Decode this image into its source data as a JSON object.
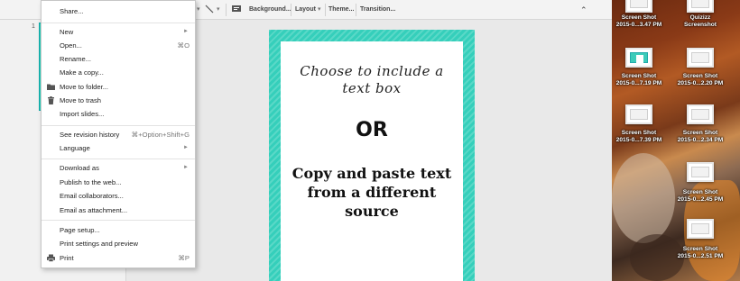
{
  "toolbar": {
    "background": "Background...",
    "layout": "Layout",
    "theme": "Theme...",
    "transition": "Transition...",
    "dropdown_arrow": "▾",
    "collapse_glyph": "⌃"
  },
  "filmstrip": {
    "slide_number": "1"
  },
  "slide": {
    "line1": "Choose to include a",
    "line2": "text box",
    "or": "OR",
    "copy_line1": "Copy and paste text",
    "copy_line2": "from a different",
    "copy_line3": "source",
    "accent_color": "#35cfbb"
  },
  "menu": {
    "share": "Share...",
    "new": "New",
    "open": "Open...",
    "open_shortcut": "⌘O",
    "rename": "Rename...",
    "make_copy": "Make a copy...",
    "move_to_folder": "Move to folder...",
    "move_to_trash": "Move to trash",
    "import_slides": "Import slides...",
    "revision_history": "See revision history",
    "revision_shortcut": "⌘+Option+Shift+G",
    "language": "Language",
    "download_as": "Download as",
    "publish": "Publish to the web...",
    "email_collaborators": "Email collaborators...",
    "email_attachment": "Email as attachment...",
    "page_setup": "Page setup...",
    "print_settings": "Print settings and preview",
    "print": "Print",
    "print_shortcut": "⌘P",
    "submenu_arrow": "►"
  },
  "desktop": {
    "icons": [
      {
        "line1": "Screen Shot",
        "line2": "2015-0...3.47 PM",
        "icon": "screenshot-thumbnail"
      },
      {
        "line1": "Quizizz",
        "line2": "Screenshot",
        "icon": "screenshot-thumbnail"
      },
      {
        "line1": "Screen Shot",
        "line2": "2015-0...7.19 PM",
        "icon": "screenshot-thumbnail-teal"
      },
      {
        "line1": "Screen Shot",
        "line2": "2015-0...2.20 PM",
        "icon": "screenshot-thumbnail"
      },
      {
        "line1": "Screen Shot",
        "line2": "2015-0...7.39 PM",
        "icon": "screenshot-thumbnail"
      },
      {
        "line1": "Screen Shot",
        "line2": "2015-0...2.34 PM",
        "icon": "screenshot-thumbnail"
      },
      {
        "line1": "Screen Shot",
        "line2": "2015-0...2.45 PM",
        "icon": "screenshot-thumbnail"
      },
      {
        "line1": "Screen Shot",
        "line2": "2015-0...2.51 PM",
        "icon": "screenshot-thumbnail"
      }
    ]
  }
}
